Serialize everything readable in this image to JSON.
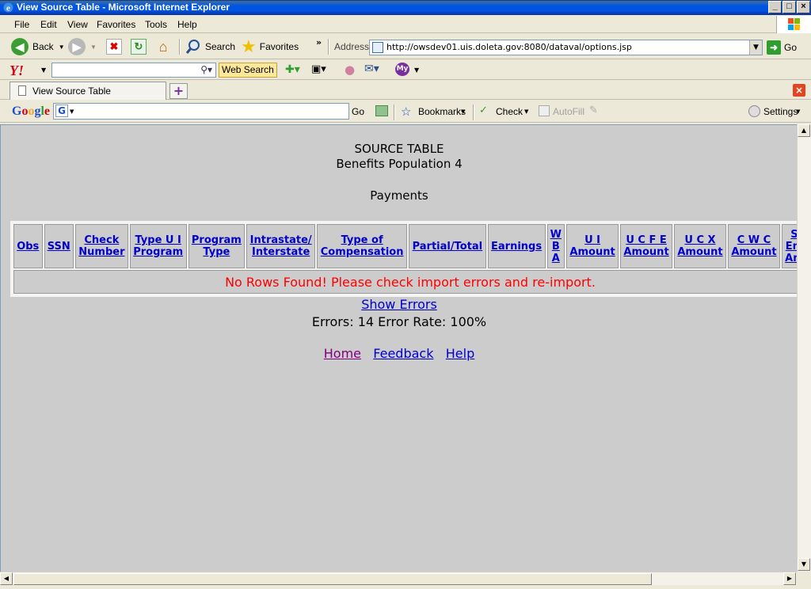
{
  "window": {
    "title": "View Source Table - Microsoft Internet Explorer",
    "min_label": "_",
    "max_label": "□",
    "close_label": "×"
  },
  "menu": {
    "items": [
      "File",
      "Edit",
      "View",
      "Favorites",
      "Tools",
      "Help"
    ]
  },
  "toolbar": {
    "back_label": "Back",
    "search_label": "Search",
    "favorites_label": "Favorites",
    "address_label": "Address",
    "url": "http://owsdev01.uis.doleta.gov:8080/dataval/options.jsp",
    "go_label": "Go"
  },
  "yahoo": {
    "logo": "Y!",
    "search_value": "",
    "web_search_label": "Web Search"
  },
  "tabs": {
    "active_label": "View Source Table"
  },
  "google": {
    "logo_letters": [
      "G",
      "o",
      "o",
      "g",
      "l",
      "e"
    ],
    "logo_colors": [
      "#1a4fc7",
      "#d0021b",
      "#f5a623",
      "#1a4fc7",
      "#2f9e2f",
      "#d0021b"
    ],
    "search_value": "",
    "go_label": "Go",
    "bookmarks_label": "Bookmarks",
    "check_label": "Check",
    "autofill_label": "AutoFill",
    "settings_label": "Settings"
  },
  "page": {
    "heading": "SOURCE TABLE",
    "subheading": "Benefits Population 4",
    "section": "Payments",
    "columns": [
      [
        "Obs"
      ],
      [
        "SSN"
      ],
      [
        "Check",
        "Number"
      ],
      [
        "Type U I",
        "Program"
      ],
      [
        "Program",
        "Type"
      ],
      [
        "Intrastate/",
        "Interstate"
      ],
      [
        "Type of",
        "Compensation"
      ],
      [
        "Partial/Total"
      ],
      [
        "Earnings"
      ],
      [
        "W",
        "B",
        "A"
      ],
      [
        "U I",
        "Amount"
      ],
      [
        "U C F E",
        "Amount"
      ],
      [
        "U C X",
        "Amount"
      ],
      [
        "C W C",
        "Amount"
      ],
      [
        "S",
        "Em",
        "Am"
      ]
    ],
    "no_rows_message": "No Rows Found! Please check import errors and re-import.",
    "show_errors_label": "Show Errors",
    "errors_summary": "Errors: 14 Error Rate: 100%",
    "footer_links": {
      "home": "Home",
      "feedback": "Feedback",
      "help": "Help"
    }
  }
}
